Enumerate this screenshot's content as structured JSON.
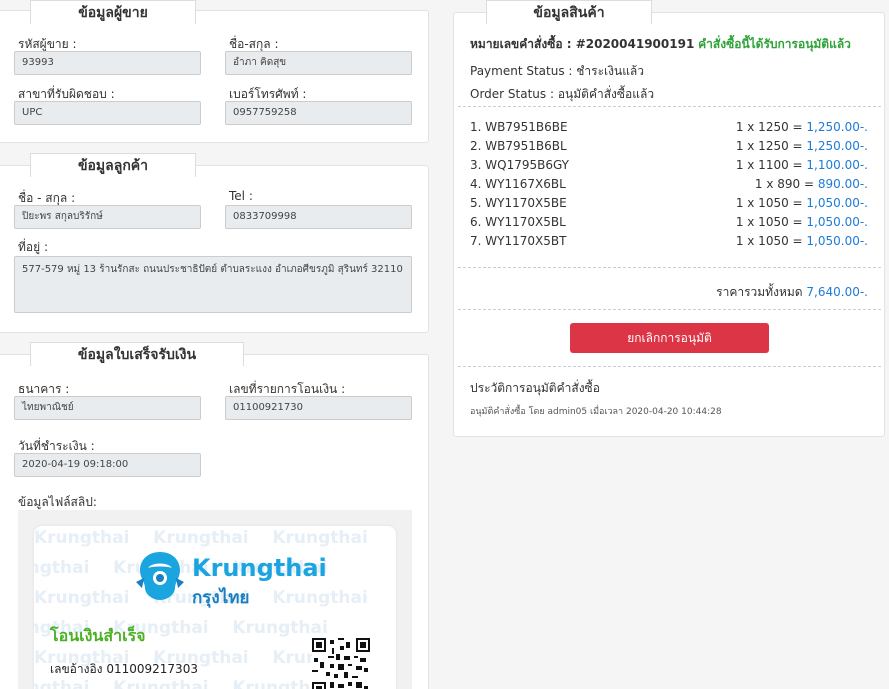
{
  "seller": {
    "legend": "ข้อมูลผู้ขาย",
    "code_label": "รหัสผู้ขาย :",
    "code_value": "93993",
    "name_label": "ชื่อ-สกุล :",
    "name_value": "อำภา คิดสุข",
    "branch_label": "สาขาที่รับผิดชอบ :",
    "branch_value": "UPC",
    "phone_label": "เบอร์โทรศัพท์ :",
    "phone_value": "0957759258"
  },
  "customer": {
    "legend": "ข้อมูลลูกค้า",
    "name_label": "ชื่อ - สกุล :",
    "name_value": "ปิยะพร สกุลบริรักษ์",
    "tel_label": "Tel :",
    "tel_value": "0833709998",
    "address_label": "ที่อยู่ :",
    "address_value": "577-579 หมู่ 13 ร้านรักสะ  ถนนประชาธิปัตย์ ตำบลระแงง อำเภอศีขรภูมิ สุรินทร์ 32110"
  },
  "receipt": {
    "legend": "ข้อมูลใบเสร็จรับเงิน",
    "bank_label": "ธนาคาร :",
    "bank_value": "ไทยพาณิชย์",
    "transfer_label": "เลขที่รายการโอนเงิน :",
    "transfer_value": "01100921730",
    "date_label": "วันที่ชำระเงิน :",
    "date_value": "2020-04-19 09:18:00",
    "slip_label": "ข้อมูลไฟล์สลิป:"
  },
  "slip": {
    "bank_name": "Krungthai",
    "bank_name_thai": "กรุงไทย",
    "watermark": "Krungthai",
    "success": "โอนเงินสำเร็จ",
    "ref": "เลขอ้างอิง 011009217303"
  },
  "product": {
    "legend": "ข้อมูลสินค้า",
    "order_label": "หมายเลขคำสั่งซื้อ : #2020041900191",
    "order_status_note": "คำสั่งซื้อนี้ได้รับการอนุมัติแล้ว",
    "payment_status": "Payment Status : ชำระเงินแล้ว",
    "order_status": "Order Status : อนุมัติคำสั่งซื้อแล้ว",
    "items": [
      {
        "name": "1. WB7951B6BE",
        "calc": "1 x 1250 = ",
        "total": "1,250.00-."
      },
      {
        "name": "2. WB7951B6BL",
        "calc": "1 x 1250 = ",
        "total": "1,250.00-."
      },
      {
        "name": "3. WQ1795B6GY",
        "calc": "1 x 1100 = ",
        "total": "1,100.00-."
      },
      {
        "name": "4. WY1167X6BL",
        "calc": "1 x 890 = ",
        "total": "890.00-."
      },
      {
        "name": "5. WY1170X5BE",
        "calc": "1 x 1050 = ",
        "total": "1,050.00-."
      },
      {
        "name": "6. WY1170X5BL",
        "calc": "1 x 1050 = ",
        "total": "1,050.00-."
      },
      {
        "name": "7. WY1170X5BT",
        "calc": "1 x 1050 = ",
        "total": "1,050.00-."
      }
    ],
    "total_label": "ราคารวมทั้งหมด",
    "total_value": "7,640.00-.",
    "cancel_button": "ยกเลิกการอนุมัติ",
    "history_title": "ประวัติการอนุมัติคำสั่งซื้อ",
    "history_entry": "อนุมัติคำสั่งซื้อ โดย admin05 เมื่อเวลา 2020-04-20 10:44:28"
  },
  "colors": {
    "accent_blue": "#1e7bd6",
    "approved_green": "#2fa33a",
    "cancel_red": "#dc3545"
  }
}
